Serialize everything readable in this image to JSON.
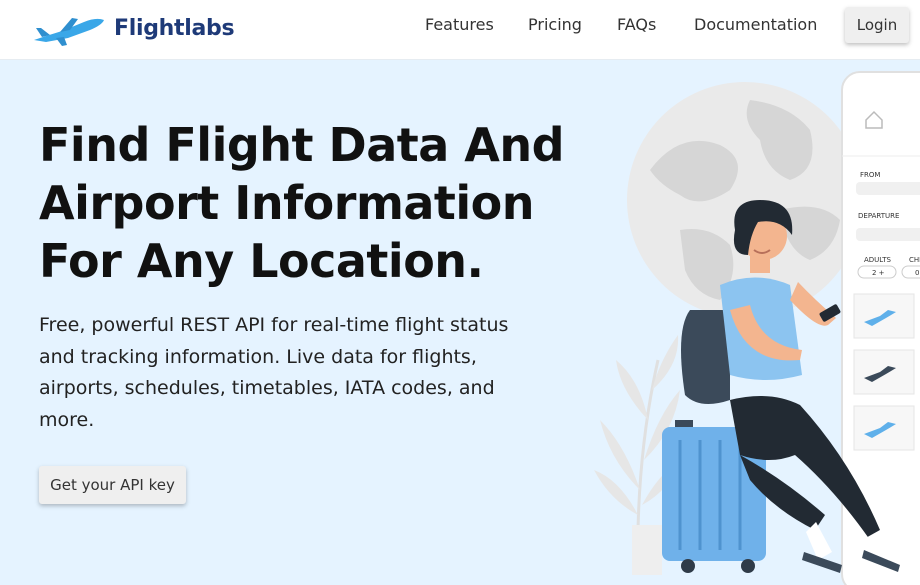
{
  "brand": {
    "name": "Flightlabs",
    "logo_icon": "airplane-icon",
    "color": "#1e3a78",
    "accent": "#3aa7e8"
  },
  "nav": {
    "links": [
      {
        "label": "Features"
      },
      {
        "label": "Pricing"
      },
      {
        "label": "FAQs"
      },
      {
        "label": "Documentation"
      }
    ],
    "login_label": "Login"
  },
  "hero": {
    "title_lines": [
      "Find Flight Data And",
      "Airport Information",
      "For Any Location."
    ],
    "description": "Free, powerful REST API for real-time flight status and tracking information. Live data for flights, airports, schedules, timetables, IATA codes, and more.",
    "cta_label": "Get your API key",
    "background": "#e5f3ff"
  },
  "phone": {
    "icon": "home-icon",
    "from_label": "FROM",
    "departure_label": "DEPARTURE",
    "adults_label": "ADULTS",
    "children_label": "CHI",
    "adults_value": "2 +",
    "children_value": "0"
  }
}
